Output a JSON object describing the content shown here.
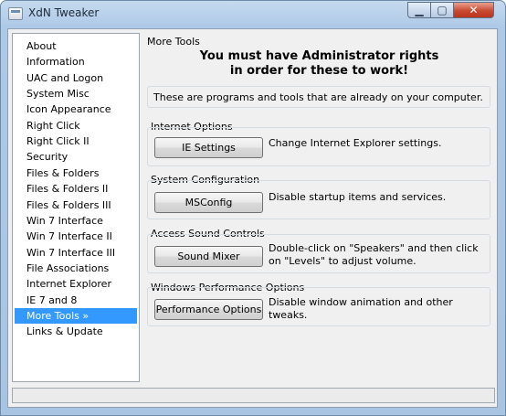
{
  "window": {
    "title": "XdN Tweaker",
    "controls": {
      "minimize_icon": "minimize-icon",
      "maximize_icon": "maximize-icon",
      "close_icon": "close-icon"
    }
  },
  "sidebar": {
    "items": [
      {
        "label": "About"
      },
      {
        "label": "Information"
      },
      {
        "label": "UAC and Logon"
      },
      {
        "label": "System Misc"
      },
      {
        "label": "Icon Appearance"
      },
      {
        "label": "Right Click"
      },
      {
        "label": "Right Click II"
      },
      {
        "label": "Security"
      },
      {
        "label": "Files & Folders"
      },
      {
        "label": "Files & Folders II"
      },
      {
        "label": "Files & Folders III"
      },
      {
        "label": "Win 7 Interface"
      },
      {
        "label": "Win 7 Interface II"
      },
      {
        "label": "Win 7 Interface III"
      },
      {
        "label": "File Associations"
      },
      {
        "label": "Internet Explorer"
      },
      {
        "label": "IE 7 and 8"
      },
      {
        "label": "More Tools »",
        "selected": true
      },
      {
        "label": "Links & Update"
      }
    ],
    "selected_color": "#3399ff"
  },
  "main": {
    "section_title": "More Tools",
    "warning_line1": "You must have Administrator rights",
    "warning_line2": "in order for these to work!",
    "intro": "These are programs and tools that are already on your computer.",
    "groups": [
      {
        "title": "Internet Options",
        "button": "IE Settings",
        "description": "Change Internet Explorer settings."
      },
      {
        "title": "System Configuration",
        "button": "MSConfig",
        "description": "Disable startup items and services."
      },
      {
        "title": "Access Sound Controls",
        "button": "Sound Mixer",
        "description": "Double-click on \"Speakers\" and then click on \"Levels\" to adjust volume."
      },
      {
        "title": "Windows Performance Options",
        "button": "Performance Options",
        "description": "Disable window animation and other tweaks."
      }
    ]
  }
}
